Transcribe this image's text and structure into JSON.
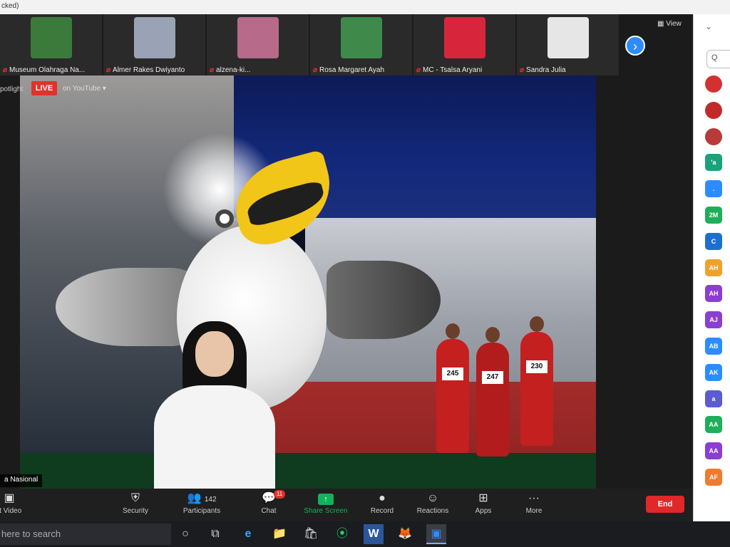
{
  "titlebar": {
    "text": "cked)"
  },
  "gallery": {
    "tiles": [
      {
        "name": "Museum Olahraga Na...",
        "thumb_color": "#3c7a3c"
      },
      {
        "name": "Almer Rakes Dwiyanto",
        "thumb_color": "#9aa3b5"
      },
      {
        "name": "alzena-ki...",
        "thumb_color": "#b86a8a"
      },
      {
        "name": "Rosa Margaret Ayah",
        "thumb_color": "#3f8a4a"
      },
      {
        "name": "MC - Tsalsa Aryani",
        "thumb_color": "#d7263b"
      },
      {
        "name": "Sandra Julia",
        "thumb_color": "#e6e6e6"
      }
    ],
    "view_label": "View",
    "next_icon": "›"
  },
  "spotlight": {
    "label": "potlight",
    "live_badge": "LIVE",
    "live_on": "on YouTube ▾"
  },
  "video": {
    "channel_tag": "a Nasional",
    "bibs": [
      "245",
      "247",
      "230"
    ]
  },
  "toolbar": {
    "start_video_icon": "▣",
    "start_video_label": "rt Video",
    "security_icon": "⛨",
    "security_label": "Security",
    "participants_icon": "👥",
    "participants_count": "142",
    "participants_label": "Participants",
    "chat_icon": "💬",
    "chat_badge": "11",
    "chat_label": "Chat",
    "share_icon": "↑",
    "share_label": "Share Screen",
    "record_icon": "●",
    "record_label": "Record",
    "reactions_icon": "☺",
    "reactions_label": "Reactions",
    "apps_icon": "⊞",
    "apps_label": "Apps",
    "more_icon": "···",
    "more_label": "More",
    "end_label": "End"
  },
  "panel": {
    "chevron": "⌄",
    "search_placeholder": "Q",
    "participants": [
      {
        "initials": "",
        "color": "#d33030",
        "photo": true
      },
      {
        "initials": "",
        "color": "#c22a2a",
        "photo": true
      },
      {
        "initials": "",
        "color": "#b83a3a",
        "photo": true
      },
      {
        "initials": "'a",
        "color": "#1aa37a"
      },
      {
        "initials": ".",
        "color": "#2d8cff"
      },
      {
        "initials": "2M",
        "color": "#1fae5a"
      },
      {
        "initials": "C",
        "color": "#1c6fd1"
      },
      {
        "initials": "AH",
        "color": "#f0a12d"
      },
      {
        "initials": "AH",
        "color": "#8b3ed1"
      },
      {
        "initials": "AJ",
        "color": "#8b3ed1"
      },
      {
        "initials": "AB",
        "color": "#2d8cff"
      },
      {
        "initials": "AK",
        "color": "#2d8cff"
      },
      {
        "initials": "a",
        "color": "#5b5bd6"
      },
      {
        "initials": "AA",
        "color": "#1fae5a"
      },
      {
        "initials": "AA",
        "color": "#8b3ed1"
      },
      {
        "initials": "AF",
        "color": "#f07a2d"
      }
    ]
  },
  "taskbar": {
    "search_text": "here to search",
    "icons": [
      "○",
      "⧉",
      "e",
      "📁",
      "🛍",
      "⦿",
      "W",
      "🦊",
      "▣"
    ]
  }
}
